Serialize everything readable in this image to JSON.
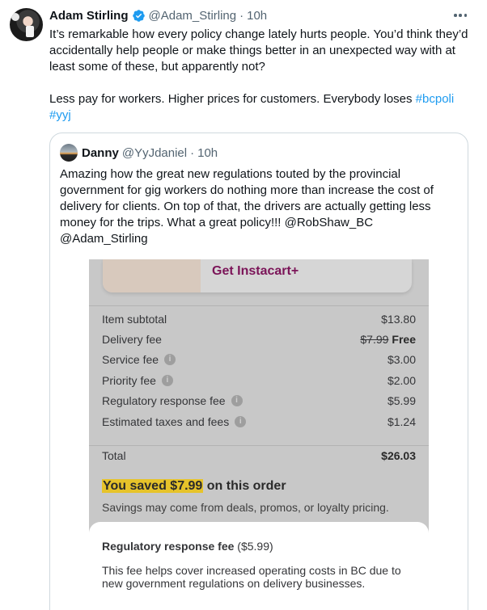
{
  "tweet": {
    "author_name": "Adam Stirling",
    "author_handle": "@Adam_Stirling",
    "separator": "·",
    "time": "10h",
    "text_p1": "It’s remarkable how every policy change lately hurts people. You’d think they’d accidentally help people or make things better in an unexpected way with at least some of these, but apparently not?",
    "text_p2": "Less pay for workers. Higher prices for customers. Everybody loses ",
    "hashtag1": "#bcpoli",
    "hashtag2": "#yyj",
    "colors": {
      "link": "#1d9bf0",
      "verified": "#1d9bf0",
      "muted": "#536471"
    }
  },
  "quote": {
    "author_name": "Danny",
    "author_handle": "@YyJdaniel",
    "separator": "·",
    "time": "10h",
    "text": "Amazing how the great new regulations touted by the provincial government for gig workers do nothing more than increase the cost of delivery for clients. On top of that, the drivers are actually getting less money for the trips. What a great policy!!! @RobShaw_BC @Adam_Stirling"
  },
  "screenshot": {
    "banner_label": "Get Instacart+",
    "rows": [
      {
        "label": "Item subtotal",
        "value": "$13.80"
      },
      {
        "label": "Delivery fee",
        "old_value": "$7.99",
        "value": "Free"
      },
      {
        "label": "Service fee",
        "value": "$3.00",
        "info_icon": "info-icon"
      },
      {
        "label": "Priority fee",
        "value": "$2.00",
        "info_icon": "info-icon"
      },
      {
        "label": "Regulatory response fee",
        "value": "$5.99",
        "info_icon": "info-icon"
      },
      {
        "label": "Estimated taxes and fees",
        "value": "$1.24",
        "info_icon": "info-icon"
      }
    ],
    "total_label": "Total",
    "total_value": "$26.03",
    "saved_highlight": "You saved $7.99",
    "saved_rest": " on this order",
    "savings_note": "Savings may come from deals, promos, or loyalty pricing.",
    "sheet_title": "Regulatory response fee",
    "sheet_amount": " ($5.99)",
    "sheet_body": "This fee helps cover increased operating costs in BC due to new government regulations on delivery businesses.",
    "colors": {
      "highlight": "#e6c32a",
      "banner_text": "#7b1458"
    }
  }
}
